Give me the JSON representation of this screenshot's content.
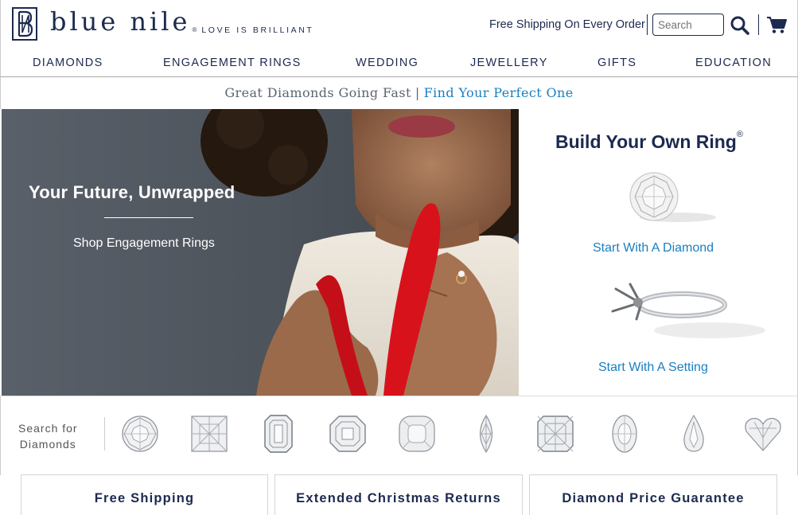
{
  "header": {
    "logo_text": "blue nile",
    "logo_reg": "®",
    "tagline": "LOVE IS BRILLIANT",
    "free_shipping": "Free Shipping On Every Order",
    "search_placeholder": "Search"
  },
  "nav": {
    "items": [
      {
        "label": "DIAMONDS"
      },
      {
        "label": "ENGAGEMENT RINGS"
      },
      {
        "label": "WEDDING"
      },
      {
        "label": "JEWELLERY"
      },
      {
        "label": "GIFTS"
      },
      {
        "label": "EDUCATION"
      }
    ]
  },
  "promo": {
    "text": "Great Diamonds Going Fast",
    "separator": "|",
    "link": "Find Your Perfect One"
  },
  "hero": {
    "title": "Your Future, Unwrapped",
    "cta": "Shop Engagement Rings"
  },
  "build": {
    "title": "Build Your Own Ring",
    "reg": "®",
    "diamond_link": "Start With A Diamond",
    "setting_link": "Start With A Setting"
  },
  "shapes": {
    "label_line1": "Search for",
    "label_line2": "Diamonds",
    "items": [
      "round",
      "princess",
      "emerald",
      "asscher",
      "cushion",
      "marquise",
      "radiant",
      "oval",
      "pear",
      "heart"
    ]
  },
  "features": [
    {
      "label": "Free Shipping"
    },
    {
      "label": "Extended Christmas Returns"
    },
    {
      "label": "Diamond Price Guarantee"
    }
  ],
  "colors": {
    "brand_navy": "#1c2a4f",
    "link_blue": "#1a7fc1",
    "ribbon_red": "#d8121b"
  }
}
